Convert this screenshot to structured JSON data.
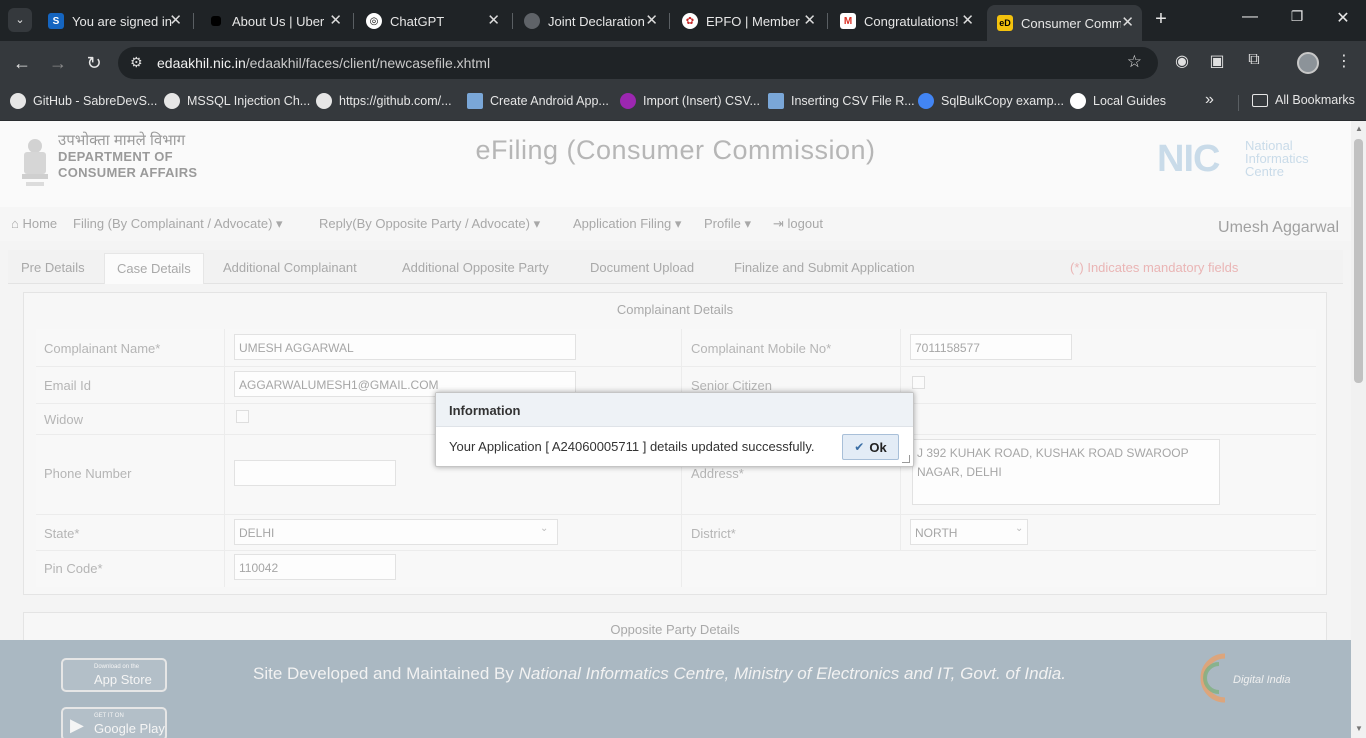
{
  "browser": {
    "tabs": [
      {
        "title": "You are signed in",
        "icon": "s-icon",
        "color": "#1565c0",
        "glyph": "S"
      },
      {
        "title": "About Us | Uber",
        "icon": "uber-icon",
        "color": "#000000",
        "glyph": "■"
      },
      {
        "title": "ChatGPT",
        "icon": "chatgpt-icon",
        "color": "#ffffff",
        "glyph": "⚙"
      },
      {
        "title": "Joint Declaration",
        "icon": "globe-icon",
        "color": "#5f6368",
        "glyph": "◐"
      },
      {
        "title": "EPFO | Member",
        "icon": "epfo-icon",
        "color": "#c62828",
        "glyph": "✿"
      },
      {
        "title": "Congratulations!",
        "icon": "gmail-icon",
        "color": "#d93025",
        "glyph": "M"
      },
      {
        "title": "Consumer Comm",
        "icon": "edaakhil-icon",
        "color": "#f4c20d",
        "glyph": "eD"
      }
    ],
    "new_tab": "+",
    "url_host": "edaakhil.nic.in",
    "url_path": "/edaakhil/faces/client/newcasefile.xhtml",
    "bookmarks": [
      {
        "label": "GitHub - SabreDevS...",
        "color": "#e6e6e6"
      },
      {
        "label": "MSSQL Injection Ch...",
        "color": "#e6e6e6"
      },
      {
        "label": "https://github.com/...",
        "color": "#e6e6e6"
      },
      {
        "label": "Create Android App...",
        "color": "#7aa7d8"
      },
      {
        "label": "Import (Insert) CSV...",
        "color": "#9c27b0"
      },
      {
        "label": "Inserting CSV File R...",
        "color": "#7aa7d8"
      },
      {
        "label": "SqlBulkCopy examp...",
        "color": "#4285f4"
      },
      {
        "label": "Local Guides",
        "color": "#ffffff"
      }
    ],
    "more_bookmarks": "»",
    "all_bookmarks": "All Bookmarks"
  },
  "header": {
    "dept_hindi": "उपभोक्ता मामले विभाग",
    "dept_line1": "DEPARTMENT OF",
    "dept_line2": "CONSUMER AFFAIRS",
    "site_title": "eFiling (Consumer Commission)",
    "nic_mark": "NIC",
    "nic_line1": "National",
    "nic_line2": "Informatics",
    "nic_line3": "Centre"
  },
  "menu": {
    "home": "Home",
    "filing": "Filing (By Complainant / Advocate)",
    "reply": "Reply(By Opposite Party / Advocate)",
    "application": "Application Filing",
    "profile": "Profile",
    "logout": "logout",
    "user": "Umesh Aggarwal"
  },
  "page_tabs": [
    "Pre Details",
    "Case Details",
    "Additional Complainant",
    "Additional Opposite Party",
    "Document Upload",
    "Finalize and Submit Application"
  ],
  "mandatory_note": "(*) Indicates mandatory fields",
  "complainant": {
    "section_title": "Complainant Details",
    "name_label": "Complainant Name*",
    "name_value": "UMESH AGGARWAL",
    "mobile_label": "Complainant Mobile No*",
    "mobile_value": "7011158577",
    "email_label": "Email Id",
    "email_value": "AGGARWALUMESH1@GMAIL.COM",
    "senior_label": "Senior Citizen",
    "widow_label": "Widow",
    "phone_label": "Phone Number",
    "phone_value": "",
    "address_label": "Address*",
    "address_value": "J 392 KUHAK ROAD, KUSHAK ROAD SWAROOP NAGAR, DELHI",
    "state_label": "State*",
    "state_value": "DELHI",
    "district_label": "District*",
    "district_value": "NORTH",
    "pin_label": "Pin Code*",
    "pin_value": "110042"
  },
  "opposite_party": {
    "section_title": "Opposite Party Details"
  },
  "footer": {
    "appstore_small": "Download on the",
    "appstore_big": "App Store",
    "play_small": "GET IT ON",
    "play_big": "Google Play",
    "text_prefix": "Site Developed and Maintained By ",
    "text_italic": "National Informatics Centre, Ministry of Electronics and IT, Govt. of India.",
    "digital_india": "Digital India"
  },
  "dialog": {
    "title": "Information",
    "message": "Your Application [ A24060005711 ] details updated successfully.",
    "ok_label": "Ok"
  }
}
